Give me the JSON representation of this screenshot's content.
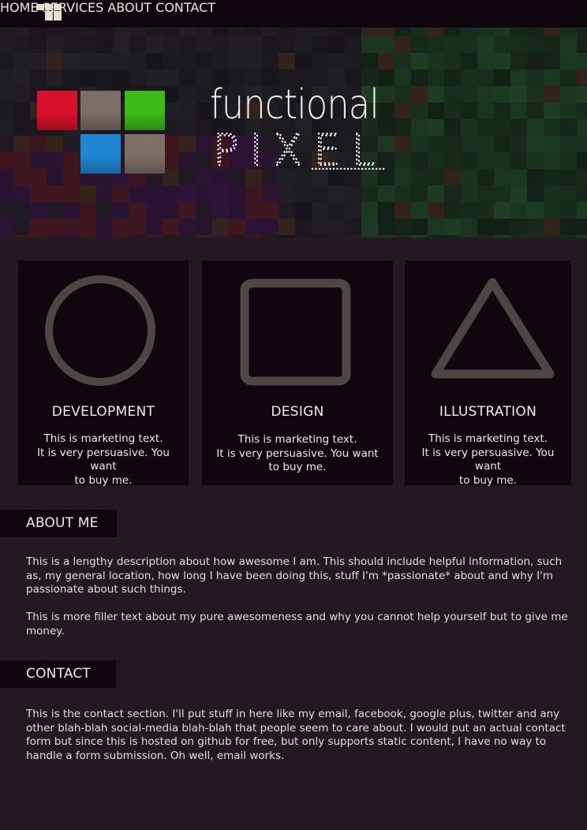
{
  "nav": {
    "items": [
      {
        "label": "HOME"
      },
      {
        "label": "SERVICES"
      },
      {
        "label": "ABOUT"
      },
      {
        "label": "CONTACT"
      }
    ]
  },
  "brand": {
    "line1": "functional",
    "line2": "PIXEL",
    "tile_colors": [
      "#d9102b",
      "#7c6e66",
      "#3dbb17",
      "#1f86d1",
      "#7d6f66"
    ]
  },
  "services": [
    {
      "icon": "circle-icon",
      "title": "DEVELOPMENT",
      "line1": "This is marketing text.",
      "line2": "It is very persuasive. You want",
      "line3": "to buy me."
    },
    {
      "icon": "square-icon",
      "title": "DESIGN",
      "line1": "This is marketing text.",
      "line2": "It is very persuasive. You want",
      "line3": "to buy me."
    },
    {
      "icon": "triangle-icon",
      "title": "ILLUSTRATION",
      "line1": "This is marketing text.",
      "line2": "It is very persuasive. You want",
      "line3": "to buy me."
    }
  ],
  "about": {
    "heading": "ABOUT ME",
    "p1": "This is a lengthy description about how awesome I am. This should include helpful information, such as, my general location, how long I have been doing this, stuff I'm *passionate* about and why I'm passionate about such things.",
    "p2": "This is more filler text about my pure awesomeness and why you cannot help yourself but to give me money."
  },
  "contact": {
    "heading": "CONTACT",
    "p1": "This is the contact section. I'll put stuff in here like my email, facebook, google plus, twitter and any other blah-blah social-media blah-blah that people seem to care about. I would put an actual contact form but since this is hosted on github for free, but only supports static content, I have no way to handle a form submission. Oh well, email works."
  }
}
